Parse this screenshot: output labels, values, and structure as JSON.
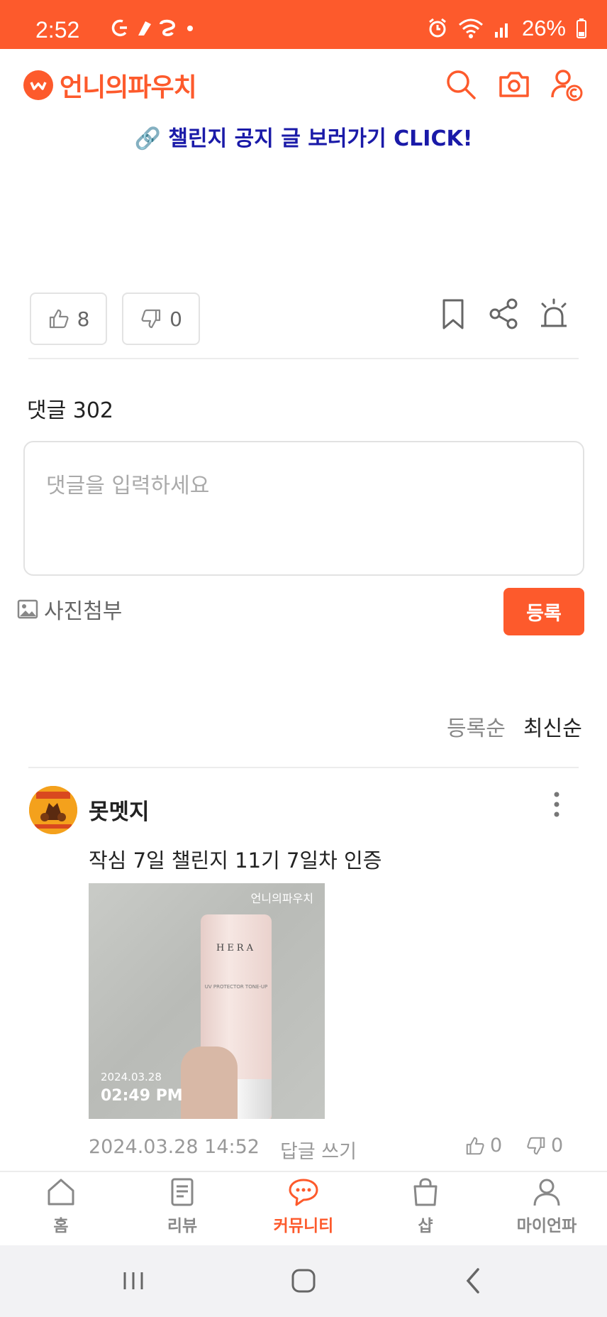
{
  "status_bar": {
    "time": "2:52",
    "battery": "26%",
    "background_color": "#fd5a2c"
  },
  "header": {
    "logo_text": "언니의파우치",
    "icons": [
      "search-icon",
      "camera-icon",
      "profile-icon"
    ],
    "brand_color": "#fd5a2c"
  },
  "post": {
    "notice_link": "🔗 챌린지 공지 글 보러가기 CLICK!",
    "likes": "8",
    "dislikes": "0"
  },
  "comments": {
    "count_label": "댓글 302",
    "input_placeholder": "댓글을 입력하세요",
    "photo_attach_label": "사진첨부",
    "submit_label": "등록",
    "sort_options": [
      "등록순",
      "최신순"
    ],
    "active_sort": "최신순",
    "items": [
      {
        "author": "못멧지",
        "text": "작심 7일 챌린지 11기 7일차 인증",
        "photo": {
          "watermark": "언니의파우치",
          "date": "2024.03.28",
          "time": "02:49 PM",
          "product_brand": "HERA",
          "product_name": "UV PROTECTOR TONE-UP"
        },
        "timestamp": "2024.03.28 14:52",
        "reply_label": "답글 쓰기",
        "likes": "0",
        "dislikes": "0"
      }
    ]
  },
  "bottom_nav": {
    "items": [
      {
        "label": "홈",
        "icon": "home-icon"
      },
      {
        "label": "리뷰",
        "icon": "review-icon"
      },
      {
        "label": "커뮤니티",
        "icon": "community-icon"
      },
      {
        "label": "샵",
        "icon": "shop-icon"
      },
      {
        "label": "마이언파",
        "icon": "my-icon"
      }
    ],
    "active": "커뮤니티"
  }
}
